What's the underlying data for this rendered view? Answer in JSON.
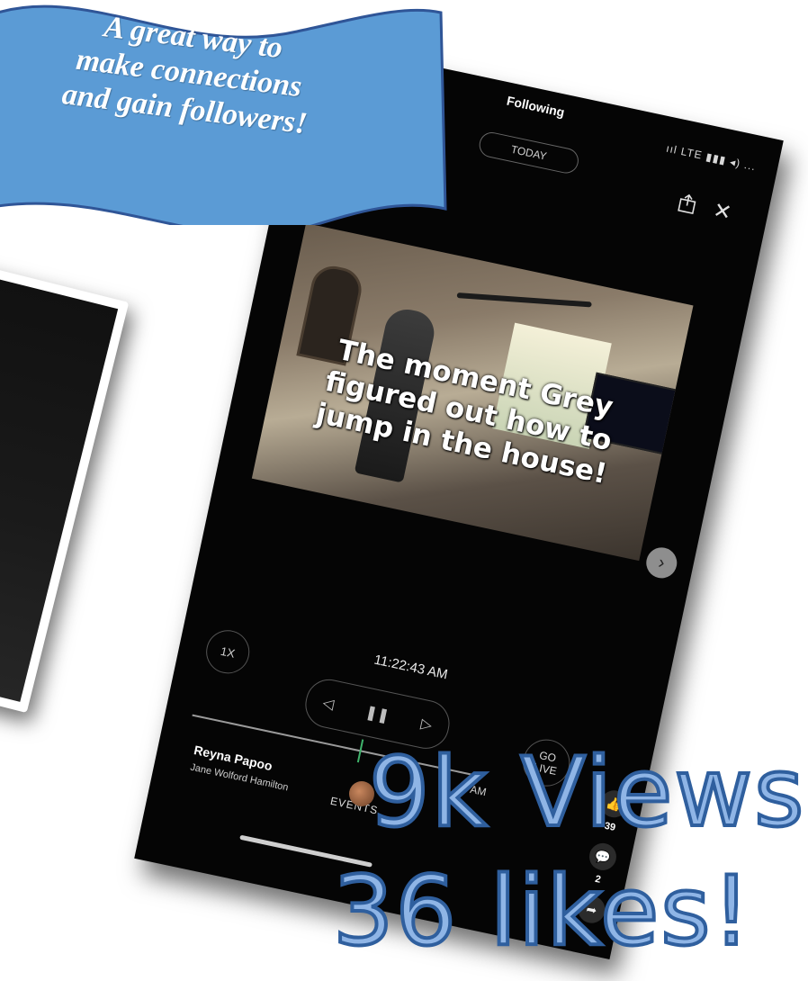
{
  "banner": {
    "text": "A great way to\nmake connections\nand gain followers!",
    "fill_color": "#5b9bd5",
    "stroke_color": "#2f5597"
  },
  "phone": {
    "status_bar": "ııl LTE ▮▮▮ ◂) ...",
    "following": "Following",
    "today": "TODAY",
    "video_caption": "The moment Grey\nfigured out how to\njump in the house!",
    "timestamp": "11:22:43 AM",
    "speed": "1X",
    "go_live": "GO\nLIVE",
    "time_small": "0 AM",
    "account_name": "Reyna Papoo",
    "account_sub": "Jane Wolford Hamilton",
    "events": "EVENTS",
    "like_count": "39",
    "comment_count": "2",
    "icons": [
      "share-icon",
      "close-icon",
      "chevron-right-icon",
      "previous-icon",
      "pause-icon",
      "next-icon",
      "thumbs-up-icon",
      "comment-icon",
      "forward-icon"
    ]
  },
  "overlay": {
    "views": "9k Views!",
    "likes": "36 likes!",
    "fill_color": "#8fb5e6",
    "outline_color": "#2f5f9e"
  }
}
